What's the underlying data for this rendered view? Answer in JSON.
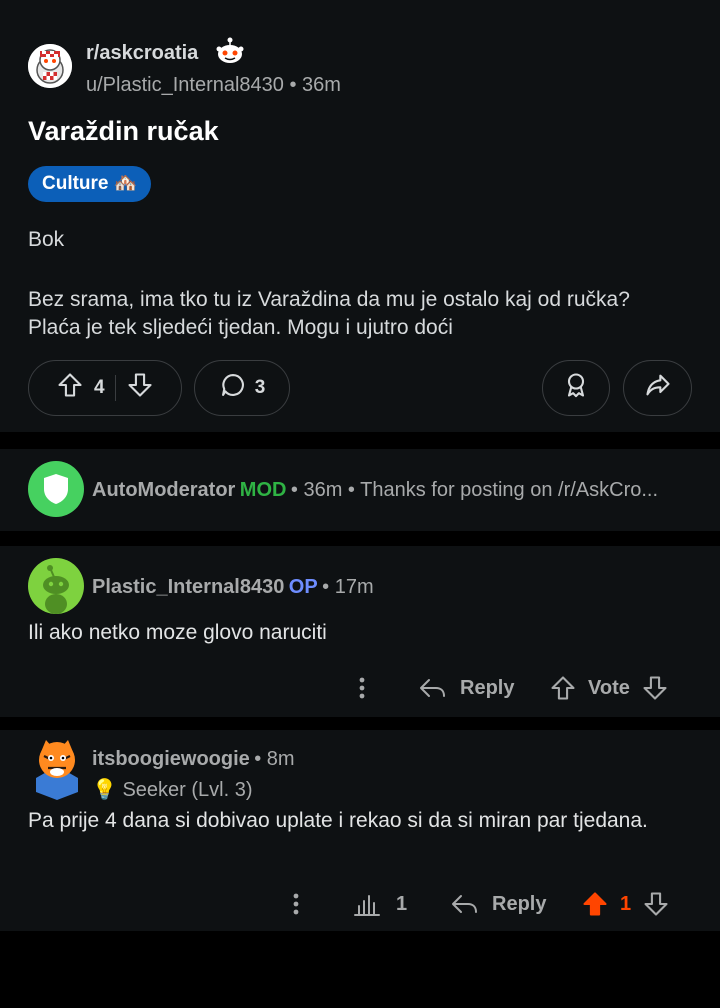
{
  "post": {
    "subreddit": "r/askcroatia",
    "author": "u/Plastic_Internal8430",
    "time": "36m",
    "title": "Varaždin ručak",
    "flair": "Culture 🏘️",
    "body": [
      "Bok",
      "Bez srama, ima tko tu iz Varaždina da mu je ostalo kaj od ručka? Plaća je tek sljedeći tjedan. Mogu i ujutro doći"
    ],
    "upvotes": "4",
    "comments": "3"
  },
  "comments": [
    {
      "author": "AutoModerator",
      "badge": "MOD",
      "time": "36m",
      "preview": "Thanks for posting on /r/AskCro..."
    },
    {
      "author": "Plastic_Internal8430",
      "badge": "OP",
      "time": "17m",
      "text": "Ili ako netko moze glovo naruciti",
      "reply_label": "Reply",
      "vote_label": "Vote"
    },
    {
      "author": "itsboogiewoogie",
      "time": "8m",
      "flair": "💡 Seeker (Lvl. 3)",
      "text": "Pa prije 4 dana si dobivao uplate i rekao si da si miran par tjedana.",
      "stats_count": "1",
      "reply_label": "Reply",
      "score": "1"
    }
  ],
  "colors": {
    "mod_green": "#2fb344",
    "op_blue": "#6e8dff",
    "upvote_orange": "#ff4500",
    "flair_blue": "#0c5fb8",
    "panel": "#0e1113"
  },
  "icons": [
    "snoo-icon",
    "upvote-icon",
    "downvote-icon",
    "comment-icon",
    "award-icon",
    "share-icon",
    "shield-icon",
    "overflow-icon",
    "reply-icon",
    "stats-icon"
  ]
}
